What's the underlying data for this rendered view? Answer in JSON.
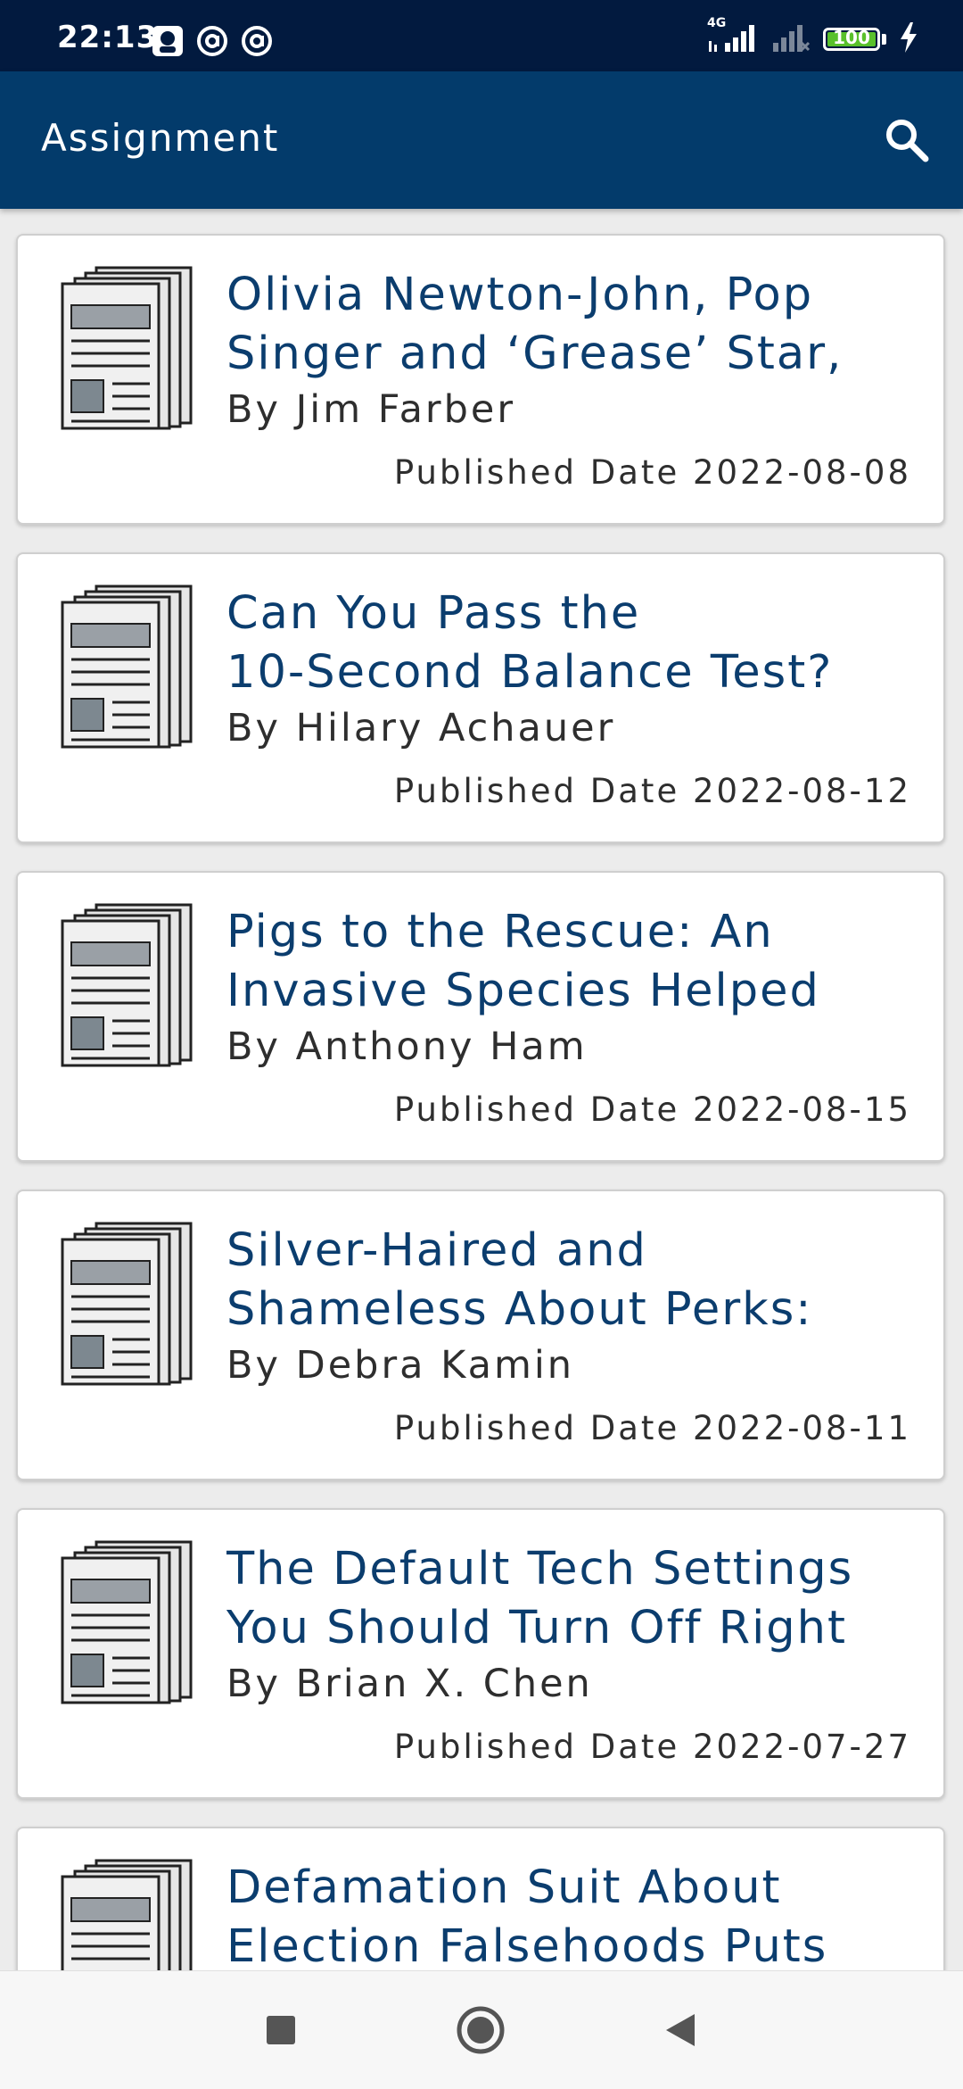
{
  "status_bar": {
    "time": "22:13",
    "battery_level": "100",
    "network_label": "4G",
    "icons": [
      "notification-app-icon",
      "at-sign-icon",
      "at-sign-icon",
      "signal-icon",
      "signal-off-icon",
      "battery-icon",
      "charging-icon"
    ]
  },
  "app_bar": {
    "title": "Assignment",
    "search_icon": "search-icon"
  },
  "articles": [
    {
      "title": "Olivia Newton-John, Pop\nSinger and ‘Grease’ Star,",
      "author": "By Jim Farber",
      "date": "Published Date 2022-08-08",
      "icon": "newspaper-icon"
    },
    {
      "title": "Can You Pass the\n10-Second Balance Test?",
      "author": "By Hilary Achauer",
      "date": "Published Date 2022-08-12",
      "icon": "newspaper-icon"
    },
    {
      "title": "Pigs to the Rescue: An\nInvasive Species Helped",
      "author": "By Anthony Ham",
      "date": "Published Date 2022-08-15",
      "icon": "newspaper-icon"
    },
    {
      "title": "Silver-Haired and\nShameless About Perks:",
      "author": "By Debra Kamin",
      "date": "Published Date 2022-08-11",
      "icon": "newspaper-icon"
    },
    {
      "title": "The Default Tech Settings\nYou Should Turn Off Right",
      "author": "By Brian X. Chen",
      "date": "Published Date 2022-07-27",
      "icon": "newspaper-icon"
    },
    {
      "title": "Defamation Suit About\nElection Falsehoods Puts",
      "author": "",
      "date": "",
      "icon": "newspaper-icon"
    }
  ],
  "nav_bar": {
    "buttons": [
      "recents-square-icon",
      "home-circle-icon",
      "back-triangle-icon"
    ]
  },
  "colors": {
    "status_bar_bg": "#021a3f",
    "app_bar_bg": "#033b6b",
    "title_text": "#0b3d6e",
    "battery_fill": "#59c02b"
  }
}
